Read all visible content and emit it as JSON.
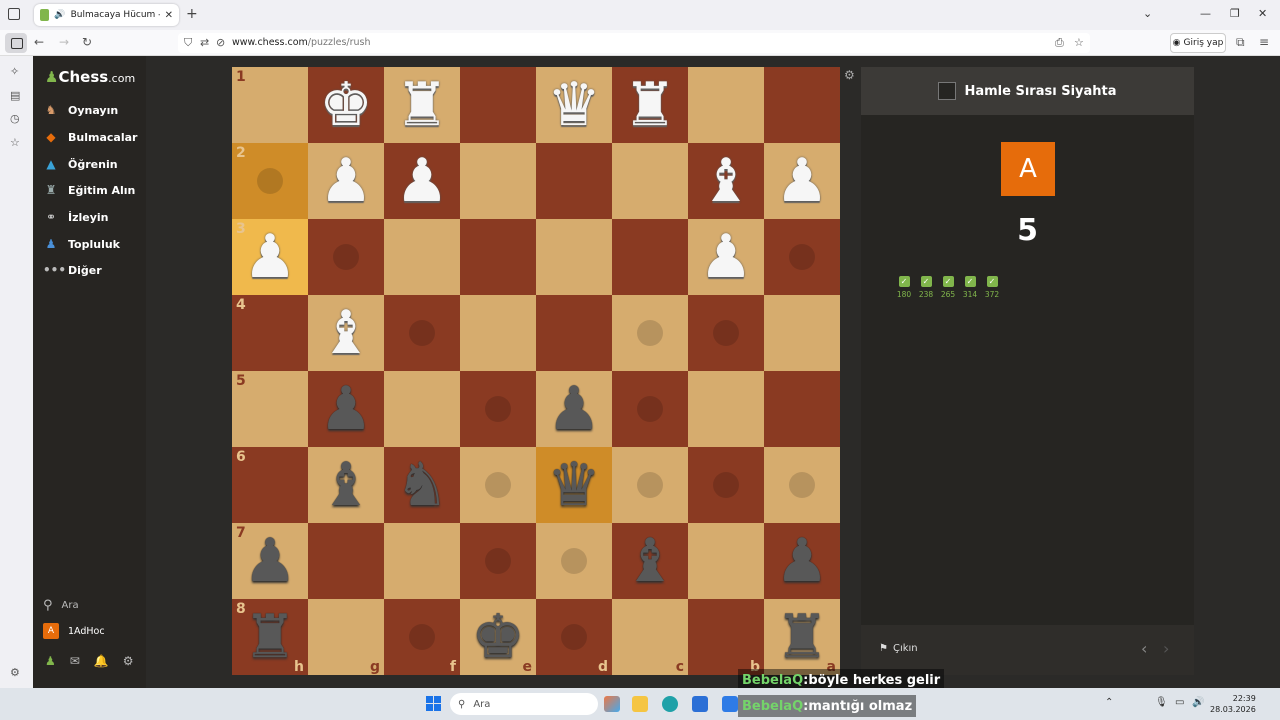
{
  "browser": {
    "tab_title": "Bulmacaya Hücum - Satranç",
    "tab_speaker": "🔊",
    "url_host": "www.chess.com",
    "url_path": "/puzzles/rush",
    "login_label": "Giriş yap"
  },
  "sidebar": {
    "logo_text": "Chess",
    "logo_suffix": ".com",
    "items": [
      {
        "label": "Oynayın",
        "icon": "play-icon"
      },
      {
        "label": "Bulmacalar",
        "icon": "puzzle-icon"
      },
      {
        "label": "Öğrenin",
        "icon": "learn-icon"
      },
      {
        "label": "Eğitim Alın",
        "icon": "train-icon"
      },
      {
        "label": "İzleyin",
        "icon": "watch-icon"
      },
      {
        "label": "Topluluk",
        "icon": "community-icon"
      },
      {
        "label": "Diğer",
        "icon": "more-icon"
      }
    ],
    "search_label": "Ara",
    "username": "1AdHoc",
    "avatar_letter": "A"
  },
  "board": {
    "ranks": [
      "1",
      "2",
      "3",
      "4",
      "5",
      "6",
      "7",
      "8"
    ],
    "files": [
      "h",
      "g",
      "f",
      "e",
      "d",
      "c",
      "b",
      "a"
    ],
    "orientation": "black-bottom",
    "highlight_squares": [
      "h2",
      "h3",
      "d6"
    ]
  },
  "panel": {
    "turn_text": "Hamle Sırası Siyahta",
    "badge_letter": "A",
    "score": "5",
    "results": [
      "180",
      "238",
      "265",
      "314",
      "372"
    ],
    "quit_label": "Çıkın"
  },
  "chat": [
    {
      "user": "BebelaQ",
      "sep": " : ",
      "message": "böyle herkes gelir"
    },
    {
      "user": "BebelaQ",
      "sep": " : ",
      "message": "mantığı olmaz"
    }
  ],
  "taskbar": {
    "search_placeholder": "Ara",
    "time": "22:39",
    "date": "28.03.2026"
  },
  "colors": {
    "accent_green": "#81b64c",
    "accent_orange": "#e66c0b",
    "board_light": "#d6ac6e",
    "board_dark": "#8a3a22",
    "highlight": "#f0b94c"
  }
}
